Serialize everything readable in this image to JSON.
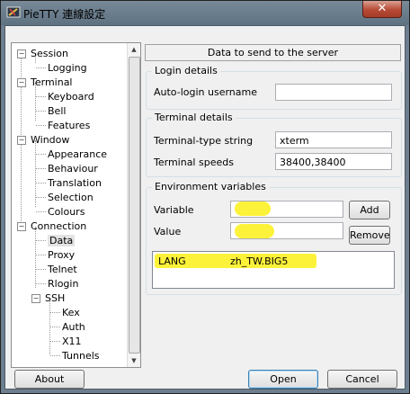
{
  "window": {
    "title": "PieTTY 連線設定",
    "close_glyph": "✕"
  },
  "tree": {
    "items": [
      {
        "label": "Session",
        "level": 0,
        "expander": "−"
      },
      {
        "label": "Logging",
        "level": 1
      },
      {
        "label": "Terminal",
        "level": 0,
        "expander": "−"
      },
      {
        "label": "Keyboard",
        "level": 1
      },
      {
        "label": "Bell",
        "level": 1
      },
      {
        "label": "Features",
        "level": 1
      },
      {
        "label": "Window",
        "level": 0,
        "expander": "−"
      },
      {
        "label": "Appearance",
        "level": 1
      },
      {
        "label": "Behaviour",
        "level": 1
      },
      {
        "label": "Translation",
        "level": 1
      },
      {
        "label": "Selection",
        "level": 1
      },
      {
        "label": "Colours",
        "level": 1
      },
      {
        "label": "Connection",
        "level": 0,
        "expander": "−"
      },
      {
        "label": "Data",
        "level": 1,
        "selected": true
      },
      {
        "label": "Proxy",
        "level": 1
      },
      {
        "label": "Telnet",
        "level": 1
      },
      {
        "label": "Rlogin",
        "level": 1
      },
      {
        "label": "SSH",
        "level": 1,
        "expander": "−"
      },
      {
        "label": "Kex",
        "level": 2
      },
      {
        "label": "Auth",
        "level": 2
      },
      {
        "label": "X11",
        "level": 2
      },
      {
        "label": "Tunnels",
        "level": 2
      }
    ],
    "scroll_up": "▲",
    "scroll_down": "▼"
  },
  "panel": {
    "header": "Data to send to the server",
    "login": {
      "title": "Login details",
      "autologin_label": "Auto-login username",
      "autologin_value": ""
    },
    "terminal": {
      "title": "Terminal details",
      "type_label": "Terminal-type string",
      "type_value": "xterm",
      "speeds_label": "Terminal speeds",
      "speeds_value": "38400,38400"
    },
    "environment": {
      "title": "Environment variables",
      "variable_label": "Variable",
      "variable_value": "",
      "value_label": "Value",
      "value_value": "",
      "add_button": "Add",
      "remove_button": "Remove",
      "entries": [
        {
          "name": "LANG",
          "value": "zh_TW.BIG5"
        }
      ]
    }
  },
  "footer": {
    "about_button": "About",
    "open_button": "Open",
    "cancel_button": "Cancel"
  },
  "colors": {
    "highlight": "#fdf23a",
    "default_button_border": "#3c7fb1"
  }
}
